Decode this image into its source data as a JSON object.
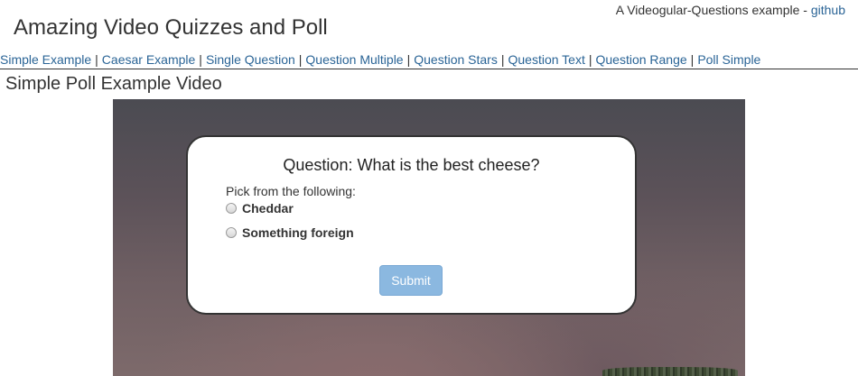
{
  "header": {
    "title": "Amazing Video Quizzes and Poll",
    "tagline": "A Videogular-Questions example - ",
    "github_link": "github"
  },
  "nav": {
    "items": [
      {
        "label": "Simple Example"
      },
      {
        "label": "Caesar Example"
      },
      {
        "label": "Single Question"
      },
      {
        "label": "Question Multiple"
      },
      {
        "label": "Question Stars"
      },
      {
        "label": "Question Text"
      },
      {
        "label": "Question Range"
      },
      {
        "label": "Poll Simple"
      }
    ],
    "separator": "|"
  },
  "page": {
    "title": "Simple Poll Example Video"
  },
  "quiz": {
    "question": "Question: What is the best cheese?",
    "instruction": "Pick from the following:",
    "options": [
      {
        "label": "Cheddar",
        "checked": false
      },
      {
        "label": "Something foreign",
        "checked": false
      }
    ],
    "submit_label": "Submit"
  },
  "colors": {
    "link": "#2a6496",
    "submit_button": "#8bb8e0"
  }
}
